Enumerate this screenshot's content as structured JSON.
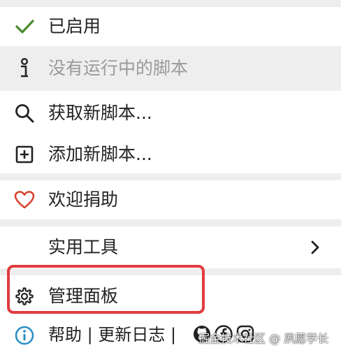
{
  "menu": {
    "enabled": {
      "label": "已启用",
      "icon": "checkmark-icon"
    },
    "no_scripts": {
      "label": "没有运行中的脚本",
      "icon": "info-icon"
    },
    "get_scripts": {
      "label": "获取新脚本...",
      "icon": "search-icon"
    },
    "add_script": {
      "label": "添加新脚本...",
      "icon": "plus-square-icon"
    },
    "donate": {
      "label": "欢迎捐助",
      "icon": "heart-icon"
    },
    "utilities": {
      "label": "实用工具",
      "icon": "chevron-right-icon"
    },
    "dashboard": {
      "label": "管理面板",
      "icon": "gear-icon"
    }
  },
  "footer": {
    "help": "帮助",
    "sep1": " | ",
    "changelog": "更新日志",
    "sep2": " |",
    "icons": [
      "github-icon",
      "facebook-icon",
      "instagram-icon"
    ]
  },
  "watermark": "掘金技术社区 @ 夙愿学长",
  "colors": {
    "check": "#4a8a2c",
    "heart": "#d9442c",
    "info_circle": "#2a8fc4",
    "highlight_border": "#e23b40",
    "separator": "#eeeeee"
  }
}
